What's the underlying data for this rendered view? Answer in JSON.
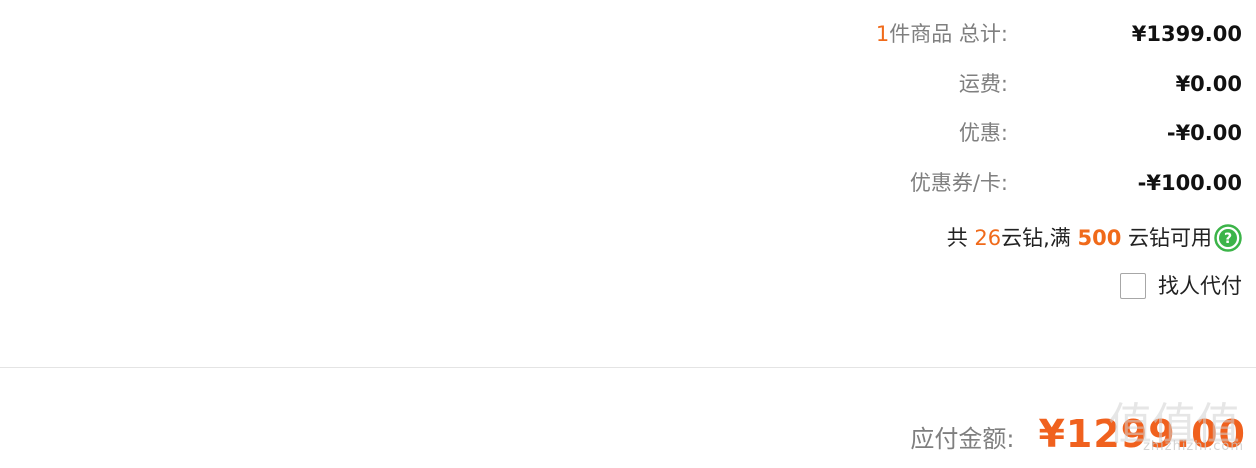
{
  "summary": {
    "items": {
      "count": "1",
      "label": "件商品 总计:",
      "value": "¥1399.00"
    },
    "shipping": {
      "label": "运费:",
      "value": "¥0.00"
    },
    "discount": {
      "label": "优惠:",
      "value": "-¥0.00"
    },
    "coupon": {
      "label": "优惠券/卡:",
      "value": "-¥100.00"
    }
  },
  "cloud_diamonds": {
    "prefix": "共 ",
    "count": "26",
    "middle": "云钻,满 ",
    "threshold": "500",
    "suffix": " 云钻可用",
    "help_icon": "question-circle-icon",
    "help_color": "#3cb449"
  },
  "proxy_pay": {
    "label": "找人代付",
    "checked": false
  },
  "total": {
    "label": "应付金额:",
    "value": "¥1299.00"
  },
  "watermark": {
    "glyphs": "值值值",
    "url": "zhizhizhi.com"
  },
  "colors": {
    "accent": "#f06a1a",
    "muted_label": "#7f7f7f",
    "divider": "#e4e4e4"
  }
}
